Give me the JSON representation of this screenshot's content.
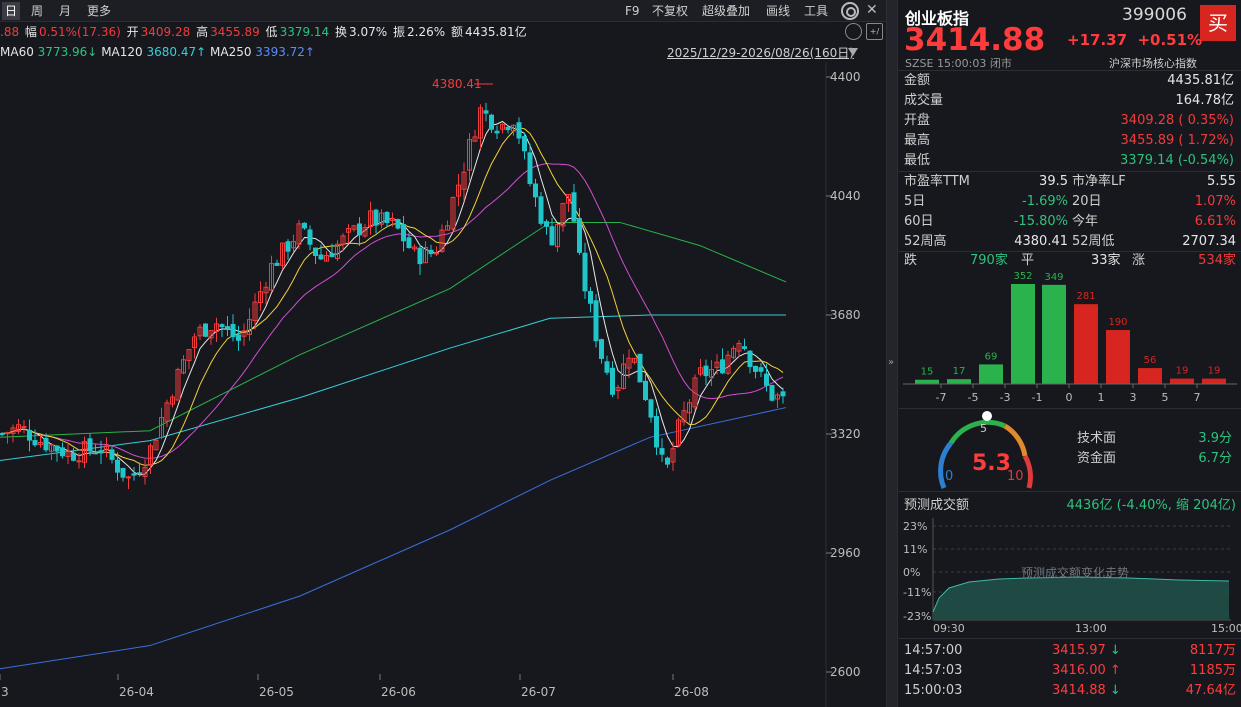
{
  "toolbar": {
    "periods": [
      "日",
      "周",
      "月",
      "更多"
    ],
    "right": [
      "F9",
      "不复权",
      "超级叠加",
      "画线",
      "工具"
    ]
  },
  "quote_line": {
    "prefix": ".88",
    "fu_label": "幅",
    "fu_value": "0.51%(17.36)",
    "kai_label": "开",
    "kai_value": "3409.28",
    "gao_label": "高",
    "gao_value": "3455.89",
    "di_label": "低",
    "di_value": "3379.14",
    "huan_label": "换",
    "huan_value": "3.07%",
    "zhen_label": "振",
    "zhen_value": "2.26%",
    "e_label": "额",
    "e_value": "4435.81亿"
  },
  "ma_line": {
    "ma60": "MA60",
    "ma60_v": "3773.96↓",
    "ma120": "MA120",
    "ma120_v": "3680.47↑",
    "ma250": "MA250",
    "ma250_v": "3393.72↑",
    "range": "2025/12/29-2026/08/26(160日)"
  },
  "chart_data": {
    "type": "candlestick",
    "y_ticks": [
      "4400",
      "4040",
      "3680",
      "3320",
      "2960",
      "2600"
    ],
    "x_ticks": [
      "3",
      "26-04",
      "26-05",
      "26-06",
      "26-07",
      "26-08"
    ],
    "high_label": "4380.41",
    "ylim": [
      2600,
      4400
    ],
    "colors": {
      "up": "#f23b3b",
      "down": "#20c5c9",
      "ma5": "#e8e8e8",
      "ma10": "#f2d23a",
      "ma20": "#d24fd2",
      "ma60": "#2bb24c",
      "ma120": "#35d0d8",
      "ma250": "#3b6fe0"
    }
  },
  "panel": {
    "name": "创业板指",
    "code": "399006",
    "buy": "买",
    "price": "3414.88",
    "change": "+17.37",
    "pct": "+0.51%",
    "exchange": "SZSE",
    "time": "15:00:03",
    "status": "闭市",
    "tag": "沪深市场核心指数",
    "jine_k": "金额",
    "jine_v": "4435.81亿",
    "cjl_k": "成交量",
    "cjl_v": "164.78亿",
    "kp_k": "开盘",
    "kp_v": "3409.28 ( 0.35%)",
    "zg_k": "最高",
    "zg_v": "3455.89 ( 1.72%)",
    "zd_k": "最低",
    "zd_v": "3379.14 (-0.54%)",
    "pe_k": "市盈率TTM",
    "pe_v": "39.5",
    "pb_k": "市净率LF",
    "pb_v": "5.55",
    "d5_k": "5日",
    "d5_v": "-1.69%",
    "d20_k": "20日",
    "d20_v": "1.07%",
    "d60_k": "60日",
    "d60_v": "-15.80%",
    "ytd_k": "今年",
    "ytd_v": "6.61%",
    "h52_k": "52周高",
    "h52_v": "4380.41",
    "l52_k": "52周低",
    "l52_v": "2707.34",
    "die_k": "跌",
    "die_v": "790家",
    "ping_k": "平",
    "ping_v": "33家",
    "zhang_k": "涨",
    "zhang_v": "534家"
  },
  "dist": {
    "labels": [
      "-7",
      "-5",
      "-3",
      "-1",
      "0",
      "1",
      "3",
      "5",
      "7"
    ],
    "values": [
      15,
      17,
      69,
      352,
      349,
      281,
      190,
      56,
      19,
      19
    ],
    "colors": [
      "#2bb24c",
      "#2bb24c",
      "#2bb24c",
      "#2bb24c",
      "#2bb24c",
      "#d7261f",
      "#d7261f",
      "#d7261f",
      "#d7261f",
      "#d7261f"
    ]
  },
  "gauge": {
    "value": "5.3",
    "min": "0",
    "mid": "5",
    "max": "10",
    "tech_k": "技术面",
    "tech_v": "3.9分",
    "fund_k": "资金面",
    "fund_v": "6.7分"
  },
  "predict": {
    "label": "预测成交额",
    "value": "4436亿 (-4.40%, 缩 204亿)",
    "y_ticks": [
      "23%",
      "11%",
      "0%",
      "-11%",
      "-23%"
    ],
    "x_ticks": [
      "09:30",
      "13:00",
      "15:00"
    ],
    "watermark": "预测成交额变化走势"
  },
  "ticks": [
    {
      "t": "14:57:00",
      "p": "3415.97",
      "arrow": "down",
      "v": "8117万"
    },
    {
      "t": "14:57:03",
      "p": "3416.00",
      "arrow": "up",
      "v": "1185万"
    },
    {
      "t": "15:00:03",
      "p": "3414.88",
      "arrow": "down",
      "v": "47.64亿"
    }
  ]
}
